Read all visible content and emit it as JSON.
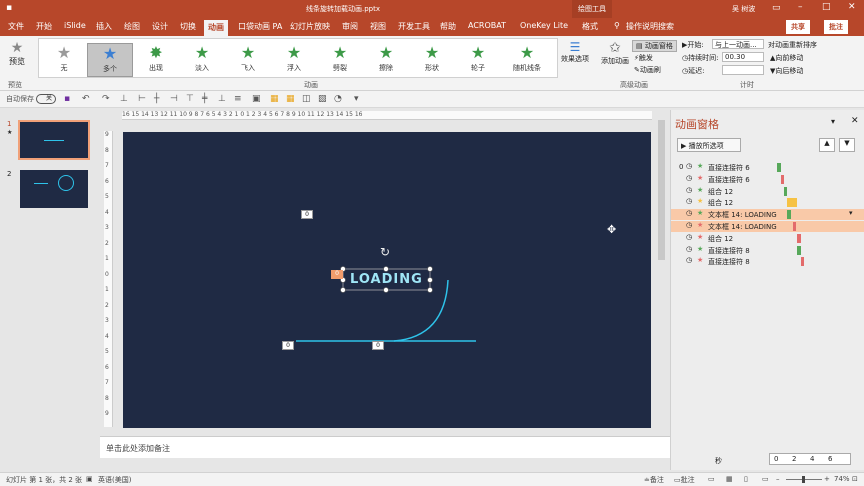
{
  "window": {
    "title": "线条旋转加载动画.pptx",
    "context_tab": "绘图工具",
    "user": "吴 树波",
    "share": "共享",
    "comment": "批注"
  },
  "tabs": [
    "文件",
    "开始",
    "iSlide",
    "插入",
    "绘图",
    "设计",
    "切换",
    "动画",
    "口袋动画 PA",
    "幻灯片放映",
    "审阅",
    "视图",
    "开发工具",
    "帮助",
    "ACROBAT",
    "OneKey Lite",
    "格式"
  ],
  "tell_me": "操作说明搜索",
  "ribbon": {
    "preview_label": "预览",
    "preview_group": "预览",
    "animations": [
      "无",
      "多个",
      "出现",
      "淡入",
      "飞入",
      "浮入",
      "劈裂",
      "擦除",
      "形状",
      "轮子",
      "随机线条"
    ],
    "effect_options": "效果选项",
    "animation_group": "动画",
    "add_animation": "添加动画",
    "anim_pane_btn": "动画窗格",
    "trigger": "触发",
    "painter": "动画刷",
    "advanced_group": "高级动画",
    "start_label": "开始:",
    "start_value": "与上一动画...",
    "duration_label": "持续时间:",
    "duration_value": "00.30",
    "delay_label": "延迟:",
    "delay_value": "",
    "reorder": "对动画重新排序",
    "move_earlier": "向前移动",
    "move_later": "向后移动",
    "timing_group": "计时"
  },
  "qat": {
    "autosave": "自动保存",
    "toggle": "关"
  },
  "thumbs": [
    {
      "num": "1",
      "star": "★"
    },
    {
      "num": "2"
    }
  ],
  "ruler": "16 15 14 13 12 11 10 9 8 7 6 5 4 3 2 1 0 1 2 3 4 5 6 7 8 9 10 11 12 13 14 15 16",
  "vruler": [
    "9",
    "8",
    "7",
    "6",
    "5",
    "4",
    "3",
    "2",
    "1",
    "0",
    "1",
    "2",
    "3",
    "4",
    "5",
    "6",
    "7",
    "8",
    "9"
  ],
  "slide": {
    "text": "LOADING",
    "tags": [
      "0",
      "0",
      "0",
      "0"
    ]
  },
  "notes": "单击此处添加备注",
  "pane": {
    "title": "动画窗格",
    "play": "播放所选项",
    "items": [
      {
        "num": "0",
        "label": "直接连接符 6",
        "bar": "#57a85a"
      },
      {
        "num": "",
        "label": "直接连接符 6",
        "bar": "#e36b6b"
      },
      {
        "num": "",
        "label": "组合 12",
        "bar": "#57a85a"
      },
      {
        "num": "",
        "label": "组合 12",
        "bar": "#f6c244"
      },
      {
        "num": "",
        "label": "文本框 14: LOADING",
        "bar": "#57a85a"
      },
      {
        "num": "",
        "label": "文本框 14: LOADING",
        "bar": "#e36b6b"
      },
      {
        "num": "",
        "label": "组合 12",
        "bar": "#e36b6b"
      },
      {
        "num": "",
        "label": "直接连接符 8",
        "bar": "#57a85a"
      },
      {
        "num": "",
        "label": "直接连接符 8",
        "bar": "#e36b6b"
      }
    ],
    "timeline_label": "秒",
    "ticks": [
      "0",
      "2",
      "4",
      "6"
    ]
  },
  "status": {
    "slide_info": "幻灯片 第 1 张，共 2 张",
    "lang": "英语(美国)",
    "notes_btn": "备注",
    "comments_btn": "批注",
    "zoom": "74%"
  },
  "colors": {
    "accent": "#b7472a",
    "slide_bg": "#1f2a44",
    "line": "#2ec3ea"
  }
}
